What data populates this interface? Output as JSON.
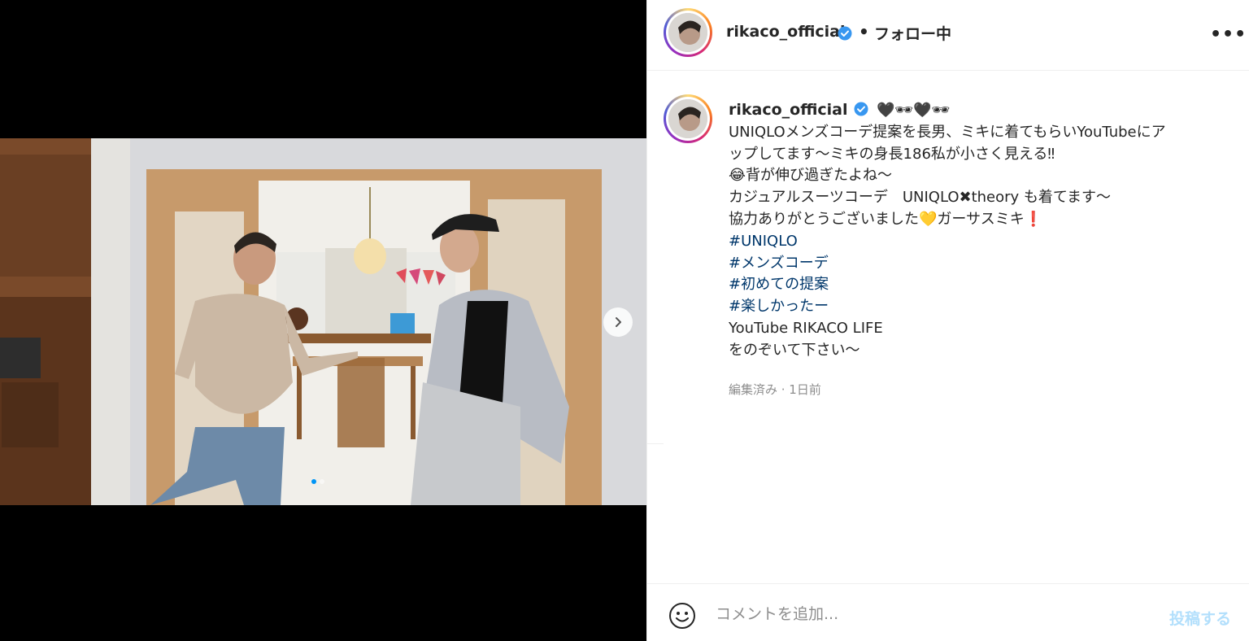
{
  "post": {
    "username": "rikaco_official",
    "follow_separator": "•",
    "follow_label": "フォロー中",
    "more_label": "•••"
  },
  "caption": {
    "username": "rikaco_official",
    "first_line_emoji": "🖤🕶🖤🕶",
    "lines": [
      "UNIQLOメンズコーデ提案を長男、ミキに着てもらいYouTubeにア",
      "ップしてます〜ミキの身長186私が小さく見える‼",
      "😂背が伸び過ぎたよね〜",
      "カジュアルスーツコーデ　UNIQLO✖theory も着てます〜",
      "協力ありがとうございました💛ガーサスミキ❗"
    ],
    "hashtags": [
      "#UNIQLO",
      "#メンズコーデ",
      "#初めての提案",
      "#楽しかったー"
    ],
    "trailing": [
      "YouTube RIKACO LIFE",
      "をのぞいて下さい〜"
    ]
  },
  "meta": {
    "edited": "編集済み · 1日前"
  },
  "comment": {
    "placeholder": "コメントを追加...",
    "post_label": "投稿する"
  },
  "carousel": {
    "current": 1,
    "total": 2
  },
  "colors": {
    "accent": "#0095f6",
    "link": "#00376b",
    "verified": "#3897f0",
    "post_disabled": "#b2dffc"
  },
  "icons": {
    "verified": "verified-badge-icon",
    "next": "chevron-right-icon",
    "emoji": "smiley-icon",
    "more": "more-options-icon"
  }
}
